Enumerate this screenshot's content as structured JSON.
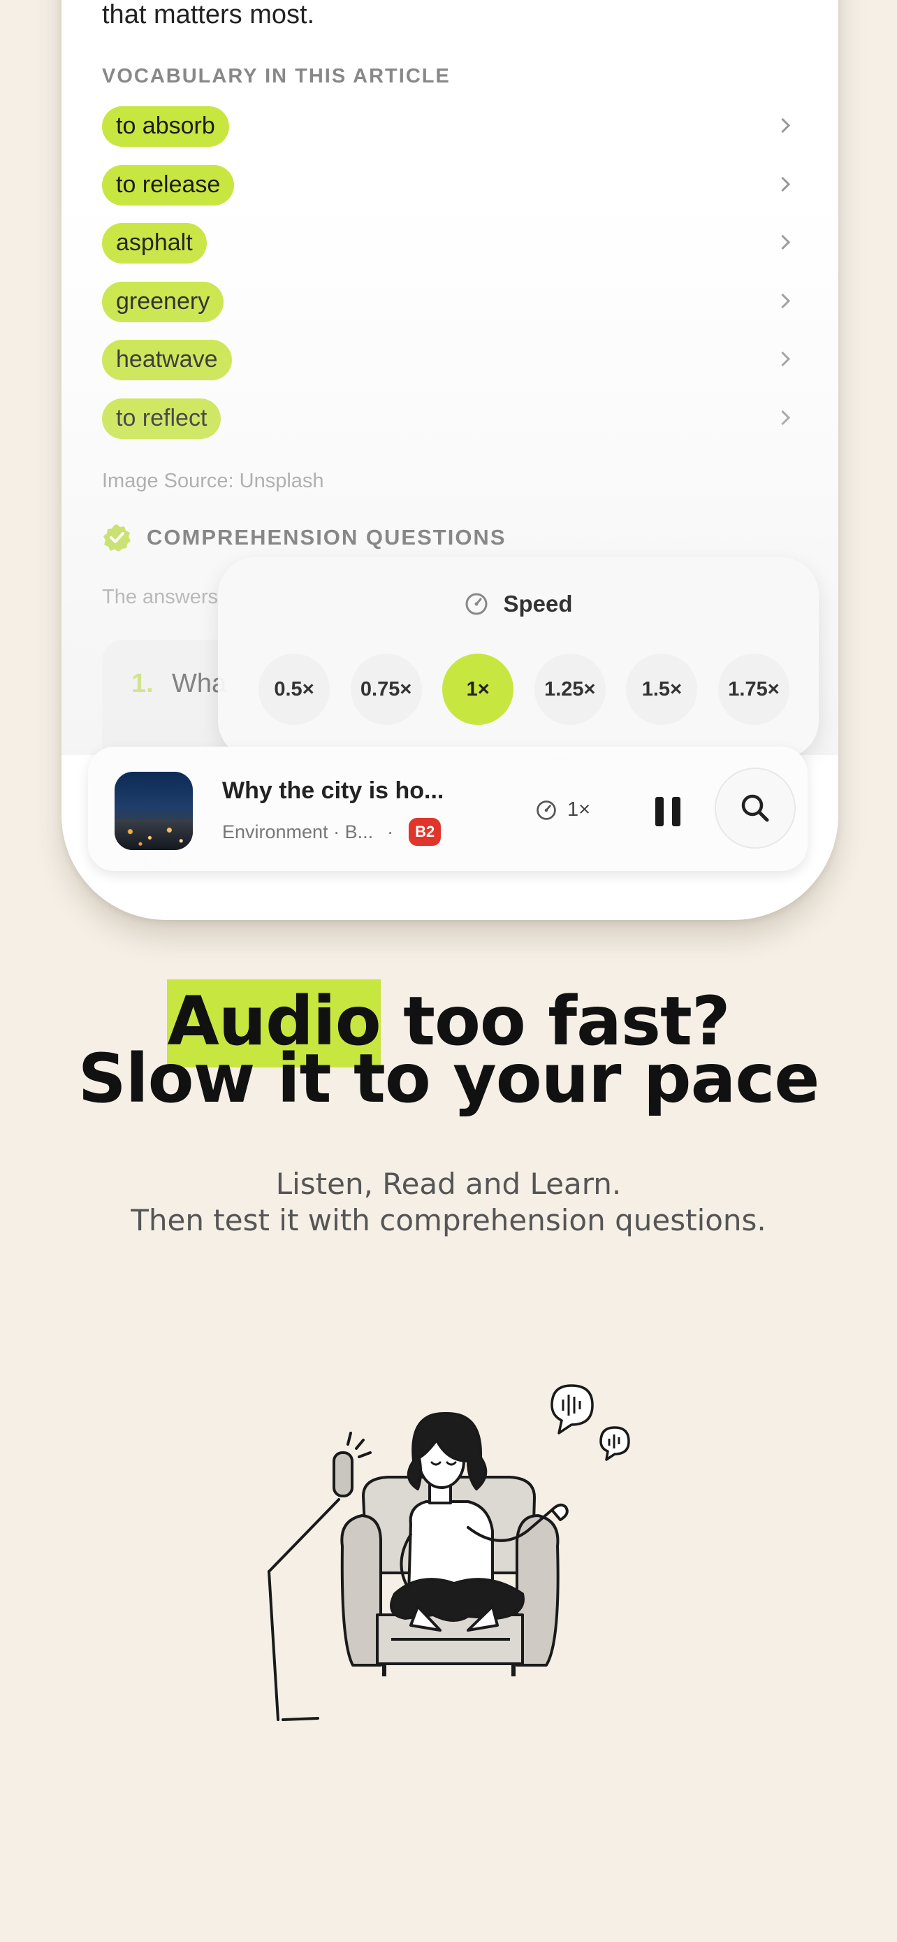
{
  "article": {
    "intro_tail": "that matters most."
  },
  "vocabulary": {
    "heading": "VOCABULARY IN THIS ARTICLE",
    "items": [
      {
        "label": "to absorb"
      },
      {
        "label": "to release"
      },
      {
        "label": "asphalt"
      },
      {
        "label": "greenery"
      },
      {
        "label": "heatwave"
      },
      {
        "label": "to reflect"
      }
    ]
  },
  "image_source": "Image Source: Unsplash",
  "comprehension": {
    "heading": "COMPREHENSION QUESTIONS",
    "answers_hint": "The answers",
    "question_number": "1.",
    "question_text_partial": "Wha"
  },
  "speed_popup": {
    "title": "Speed",
    "options": [
      "0.5×",
      "0.75×",
      "1×",
      "1.25×",
      "1.5×",
      "1.75×"
    ],
    "selected": "1×"
  },
  "player": {
    "title": "Why the city is ho...",
    "category": "Environment · B...",
    "separator": "·",
    "level": "B2",
    "speed": "1×"
  },
  "marketing": {
    "headline_highlight": "Audio",
    "headline_rest_line1": " too fast?",
    "headline_line2": "Slow it to your pace",
    "subtext_line1": "Listen, Read and Learn.",
    "subtext_line2": "Then test it with comprehension questions."
  },
  "colors": {
    "accent": "#c8e640",
    "background": "#f5efe6",
    "level_badge": "#e0352b"
  }
}
